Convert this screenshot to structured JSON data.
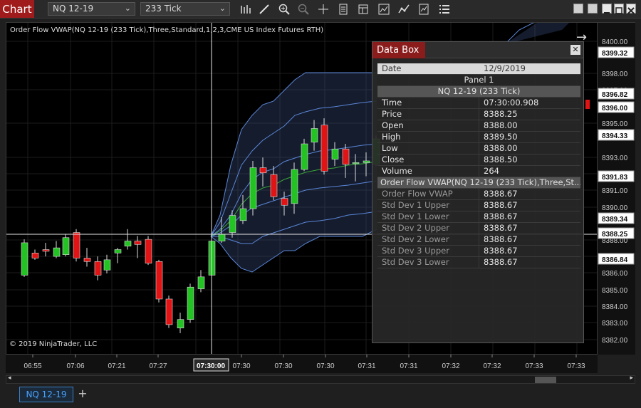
{
  "toolbar": {
    "chart_label": "Chart",
    "instrument": "NQ 12-19",
    "interval": "233 Tick"
  },
  "chart": {
    "title": "Order Flow VWAP(NQ 12-19 (233 Tick),Three,Standard,1,2,3,CME US Index Futures RTH)",
    "copyright": "© 2019 NinjaTrader, LLC",
    "price_ticks": [
      "8400.00",
      "8398.00",
      "8397.00",
      "8395.00",
      "8393.00",
      "8392.00",
      "8391.00",
      "8390.00",
      "8388.00",
      "8387.00",
      "8386.00",
      "8385.00",
      "8384.00",
      "8383.00",
      "8382.00"
    ],
    "price_flags": [
      {
        "label": "8399.32",
        "color": "#ffffff"
      },
      {
        "label": "8396.82",
        "color": "#ffffff"
      },
      {
        "label": "8396.00",
        "color": "#ffffff"
      },
      {
        "label": "8394.33",
        "color": "#ffffff"
      },
      {
        "label": "8391.83",
        "color": "#ffffff"
      },
      {
        "label": "8389.34",
        "color": "#ffffff"
      },
      {
        "label": "8388.25",
        "color": "#ffffff"
      },
      {
        "label": "8386.84",
        "color": "#ffffff"
      }
    ],
    "time_ticks": [
      "06:55",
      "07:06",
      "07:21",
      "07:27",
      "07:30",
      "07:30",
      "07:30",
      "07:31",
      "07:31",
      "07:32",
      "07:32",
      "07:33",
      "07:33"
    ],
    "crosshair_time": "07:30:00"
  },
  "databox": {
    "title": "Data Box",
    "date_label": "Date",
    "date_value": "12/9/2019",
    "panel_label": "Panel 1",
    "series_label": "NQ 12-19 (233 Tick)",
    "rows": [
      {
        "k": "Time",
        "v": "07:30:00.908"
      },
      {
        "k": "Price",
        "v": "8388.25"
      },
      {
        "k": "Open",
        "v": "8388.00"
      },
      {
        "k": "High",
        "v": "8389.50"
      },
      {
        "k": "Low",
        "v": "8388.00"
      },
      {
        "k": "Close",
        "v": "8388.50"
      },
      {
        "k": "Volume",
        "v": "264"
      }
    ],
    "indicator_label": "Order Flow VWAP(NQ 12-19 (233 Tick),Three,St...",
    "indicator_rows": [
      {
        "k": "Order Flow VWAP",
        "v": "8388.67"
      },
      {
        "k": "Std Dev 1 Upper",
        "v": "8388.67"
      },
      {
        "k": "Std Dev 1 Lower",
        "v": "8388.67"
      },
      {
        "k": "Std Dev 2 Upper",
        "v": "8388.67"
      },
      {
        "k": "Std Dev 2 Lower",
        "v": "8388.67"
      },
      {
        "k": "Std Dev 3 Upper",
        "v": "8388.67"
      },
      {
        "k": "Std Dev 3 Lower",
        "v": "8388.67"
      }
    ]
  },
  "tabs": {
    "active": "NQ 12-19",
    "add": "+"
  },
  "colors": {
    "up": "#22c322",
    "down": "#e01414",
    "band": "#5a86d8",
    "vwap": "#3aa53a",
    "accent": "#a01c1c"
  }
}
